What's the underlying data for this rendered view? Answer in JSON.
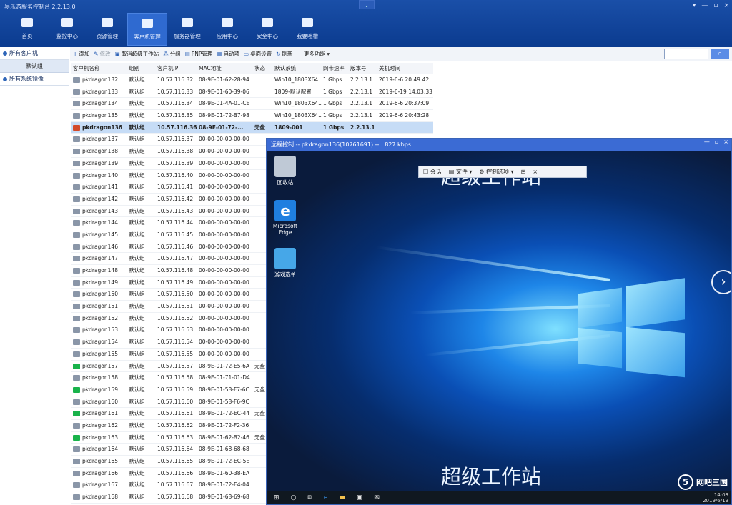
{
  "app": {
    "title": "易乐游服务控制台 2.2.13.0",
    "collapse_glyph": "⌄",
    "window_controls": [
      "▾",
      "—",
      "▫",
      "×"
    ]
  },
  "nav": {
    "items": [
      {
        "label": "首页",
        "icon": "home-icon"
      },
      {
        "label": "监控中心",
        "icon": "eye-icon"
      },
      {
        "label": "资源管理",
        "icon": "gamepad-icon"
      },
      {
        "label": "客户机管理",
        "icon": "monitor-icon",
        "active": true
      },
      {
        "label": "服务器管理",
        "icon": "server-icon"
      },
      {
        "label": "应用中心",
        "icon": "toolbox-icon"
      },
      {
        "label": "安全中心",
        "icon": "shield-icon"
      },
      {
        "label": "我要吐槽",
        "icon": "comment-icon"
      }
    ]
  },
  "sidebar": {
    "all_clients": "所有客户机",
    "default_group": "默认组",
    "all_images": "所有系统镜像"
  },
  "actions": {
    "add": "添加",
    "modify": "修改",
    "cancel_super": "取消超级工作站",
    "group": "分组",
    "pnp": "PNP管理",
    "boot": "启动项",
    "desktop": "桌面设置",
    "refresh": "刷新",
    "more": "更多功能"
  },
  "search": {
    "placeholder": "",
    "button_glyph": "⌕"
  },
  "table": {
    "headers": [
      "客户机名称",
      "组别",
      "客户机IP",
      "MAC地址",
      "状态",
      "默认系统",
      "网卡速率",
      "版本号",
      "关机时间"
    ],
    "rows": [
      {
        "name": "pkdragon132",
        "group": "默认组",
        "ip": "10.57.116.32",
        "mac": "08-9E-01-62-28-94",
        "status": "",
        "os": "Win10_1803X64...",
        "speed": "1 Gbps",
        "ver": "2.2.13.1",
        "shut": "2019-6-6 20:49:42",
        "icon": "gray"
      },
      {
        "name": "pkdragon133",
        "group": "默认组",
        "ip": "10.57.116.33",
        "mac": "08-9E-01-60-39-06",
        "status": "",
        "os": "1809-默认配置",
        "speed": "1 Gbps",
        "ver": "2.2.13.1",
        "shut": "2019-6-19 14:03:33",
        "icon": "gray"
      },
      {
        "name": "pkdragon134",
        "group": "默认组",
        "ip": "10.57.116.34",
        "mac": "08-9E-01-4A-01-CE",
        "status": "",
        "os": "Win10_1803X64...",
        "speed": "1 Gbps",
        "ver": "2.2.13.1",
        "shut": "2019-6-6 20:37:09",
        "icon": "gray"
      },
      {
        "name": "pkdragon135",
        "group": "默认组",
        "ip": "10.57.116.35",
        "mac": "08-9E-01-72-B7-98",
        "status": "",
        "os": "Win10_1803X64...",
        "speed": "1 Gbps",
        "ver": "2.2.13.1",
        "shut": "2019-6-6 20:43:28",
        "icon": "gray"
      },
      {
        "name": "pkdragon136",
        "group": "默认组",
        "ip": "10.57.116.36",
        "mac": "08-9E-01-72-...",
        "status": "无盘",
        "os": "1809-001",
        "speed": "1 Gbps",
        "ver": "2.2.13.1",
        "shut": "",
        "icon": "red",
        "selected": true
      },
      {
        "name": "pkdragon137",
        "group": "默认组",
        "ip": "10.57.116.37",
        "mac": "00-00-00-00-00-00",
        "status": "",
        "os": "",
        "speed": "",
        "ver": "",
        "shut": "",
        "icon": "gray"
      },
      {
        "name": "pkdragon138",
        "group": "默认组",
        "ip": "10.57.116.38",
        "mac": "00-00-00-00-00-00",
        "status": "",
        "os": "",
        "speed": "",
        "ver": "",
        "shut": "",
        "icon": "gray"
      },
      {
        "name": "pkdragon139",
        "group": "默认组",
        "ip": "10.57.116.39",
        "mac": "00-00-00-00-00-00",
        "status": "",
        "os": "",
        "speed": "",
        "ver": "",
        "shut": "",
        "icon": "gray"
      },
      {
        "name": "pkdragon140",
        "group": "默认组",
        "ip": "10.57.116.40",
        "mac": "00-00-00-00-00-00",
        "status": "",
        "os": "",
        "speed": "",
        "ver": "",
        "shut": "",
        "icon": "gray"
      },
      {
        "name": "pkdragon141",
        "group": "默认组",
        "ip": "10.57.116.41",
        "mac": "00-00-00-00-00-00",
        "status": "",
        "os": "",
        "speed": "",
        "ver": "",
        "shut": "",
        "icon": "gray"
      },
      {
        "name": "pkdragon142",
        "group": "默认组",
        "ip": "10.57.116.42",
        "mac": "00-00-00-00-00-00",
        "status": "",
        "os": "",
        "speed": "",
        "ver": "",
        "shut": "",
        "icon": "gray"
      },
      {
        "name": "pkdragon143",
        "group": "默认组",
        "ip": "10.57.116.43",
        "mac": "00-00-00-00-00-00",
        "status": "",
        "os": "",
        "speed": "",
        "ver": "",
        "shut": "",
        "icon": "gray"
      },
      {
        "name": "pkdragon144",
        "group": "默认组",
        "ip": "10.57.116.44",
        "mac": "00-00-00-00-00-00",
        "status": "",
        "os": "",
        "speed": "",
        "ver": "",
        "shut": "",
        "icon": "gray"
      },
      {
        "name": "pkdragon145",
        "group": "默认组",
        "ip": "10.57.116.45",
        "mac": "00-00-00-00-00-00",
        "status": "",
        "os": "",
        "speed": "",
        "ver": "",
        "shut": "",
        "icon": "gray"
      },
      {
        "name": "pkdragon146",
        "group": "默认组",
        "ip": "10.57.116.46",
        "mac": "00-00-00-00-00-00",
        "status": "",
        "os": "",
        "speed": "",
        "ver": "",
        "shut": "",
        "icon": "gray"
      },
      {
        "name": "pkdragon147",
        "group": "默认组",
        "ip": "10.57.116.47",
        "mac": "00-00-00-00-00-00",
        "status": "",
        "os": "",
        "speed": "",
        "ver": "",
        "shut": "",
        "icon": "gray"
      },
      {
        "name": "pkdragon148",
        "group": "默认组",
        "ip": "10.57.116.48",
        "mac": "00-00-00-00-00-00",
        "status": "",
        "os": "",
        "speed": "",
        "ver": "",
        "shut": "",
        "icon": "gray"
      },
      {
        "name": "pkdragon149",
        "group": "默认组",
        "ip": "10.57.116.49",
        "mac": "00-00-00-00-00-00",
        "status": "",
        "os": "",
        "speed": "",
        "ver": "",
        "shut": "",
        "icon": "gray"
      },
      {
        "name": "pkdragon150",
        "group": "默认组",
        "ip": "10.57.116.50",
        "mac": "00-00-00-00-00-00",
        "status": "",
        "os": "",
        "speed": "",
        "ver": "",
        "shut": "",
        "icon": "gray"
      },
      {
        "name": "pkdragon151",
        "group": "默认组",
        "ip": "10.57.116.51",
        "mac": "00-00-00-00-00-00",
        "status": "",
        "os": "",
        "speed": "",
        "ver": "",
        "shut": "",
        "icon": "gray"
      },
      {
        "name": "pkdragon152",
        "group": "默认组",
        "ip": "10.57.116.52",
        "mac": "00-00-00-00-00-00",
        "status": "",
        "os": "",
        "speed": "",
        "ver": "",
        "shut": "",
        "icon": "gray"
      },
      {
        "name": "pkdragon153",
        "group": "默认组",
        "ip": "10.57.116.53",
        "mac": "00-00-00-00-00-00",
        "status": "",
        "os": "",
        "speed": "",
        "ver": "",
        "shut": "",
        "icon": "gray"
      },
      {
        "name": "pkdragon154",
        "group": "默认组",
        "ip": "10.57.116.54",
        "mac": "00-00-00-00-00-00",
        "status": "",
        "os": "",
        "speed": "",
        "ver": "",
        "shut": "",
        "icon": "gray"
      },
      {
        "name": "pkdragon155",
        "group": "默认组",
        "ip": "10.57.116.55",
        "mac": "00-00-00-00-00-00",
        "status": "",
        "os": "",
        "speed": "",
        "ver": "",
        "shut": "",
        "icon": "gray"
      },
      {
        "name": "pkdragon157",
        "group": "默认组",
        "ip": "10.57.116.57",
        "mac": "08-9E-01-72-E5-6A",
        "status": "无盘",
        "os": "",
        "speed": "",
        "ver": "",
        "shut": "",
        "icon": "green"
      },
      {
        "name": "pkdragon158",
        "group": "默认组",
        "ip": "10.57.116.58",
        "mac": "08-9E-01-71-01-D4",
        "status": "",
        "os": "",
        "speed": "",
        "ver": "",
        "shut": "",
        "icon": "gray"
      },
      {
        "name": "pkdragon159",
        "group": "默认组",
        "ip": "10.57.116.59",
        "mac": "08-9E-01-58-F7-6C",
        "status": "无盘",
        "os": "",
        "speed": "",
        "ver": "",
        "shut": "",
        "icon": "green"
      },
      {
        "name": "pkdragon160",
        "group": "默认组",
        "ip": "10.57.116.60",
        "mac": "08-9E-01-58-F6-9C",
        "status": "",
        "os": "",
        "speed": "",
        "ver": "",
        "shut": "",
        "icon": "gray"
      },
      {
        "name": "pkdragon161",
        "group": "默认组",
        "ip": "10.57.116.61",
        "mac": "08-9E-01-72-EC-44",
        "status": "无盘",
        "os": "",
        "speed": "",
        "ver": "",
        "shut": "",
        "icon": "green"
      },
      {
        "name": "pkdragon162",
        "group": "默认组",
        "ip": "10.57.116.62",
        "mac": "08-9E-01-72-F2-36",
        "status": "",
        "os": "",
        "speed": "",
        "ver": "",
        "shut": "",
        "icon": "gray"
      },
      {
        "name": "pkdragon163",
        "group": "默认组",
        "ip": "10.57.116.63",
        "mac": "08-9E-01-62-B2-46",
        "status": "无盘",
        "os": "",
        "speed": "",
        "ver": "",
        "shut": "",
        "icon": "green"
      },
      {
        "name": "pkdragon164",
        "group": "默认组",
        "ip": "10.57.116.64",
        "mac": "08-9E-01-68-68-68",
        "status": "",
        "os": "",
        "speed": "",
        "ver": "",
        "shut": "",
        "icon": "gray"
      },
      {
        "name": "pkdragon165",
        "group": "默认组",
        "ip": "10.57.116.65",
        "mac": "08-9E-01-72-EC-5E",
        "status": "",
        "os": "",
        "speed": "",
        "ver": "",
        "shut": "",
        "icon": "gray"
      },
      {
        "name": "pkdragon166",
        "group": "默认组",
        "ip": "10.57.116.66",
        "mac": "08-9E-01-60-38-EA",
        "status": "",
        "os": "",
        "speed": "",
        "ver": "",
        "shut": "",
        "icon": "gray"
      },
      {
        "name": "pkdragon167",
        "group": "默认组",
        "ip": "10.57.116.67",
        "mac": "08-9E-01-72-E4-04",
        "status": "",
        "os": "",
        "speed": "",
        "ver": "",
        "shut": "",
        "icon": "gray"
      },
      {
        "name": "pkdragon168",
        "group": "默认组",
        "ip": "10.57.116.68",
        "mac": "08-9E-01-68-69-68",
        "status": "",
        "os": "",
        "speed": "",
        "ver": "",
        "shut": "",
        "icon": "gray"
      }
    ]
  },
  "remote": {
    "title": "远程控制 -- pkdragon136(10761691) -- : 827 kbps",
    "toolbar": {
      "chat": "会话",
      "file": "文件",
      "control": "控制选项"
    },
    "desktop_title": "超级工作站",
    "icons": [
      {
        "label": "回收站",
        "icon": "recycle-bin-icon",
        "color": "#bfc9d6"
      },
      {
        "label": "Microsoft Edge",
        "icon": "edge-icon",
        "color": "#1f7fe0"
      },
      {
        "label": "游戏选单",
        "icon": "game-menu-icon",
        "color": "#46a7e8"
      }
    ],
    "tray": {
      "time": "14:03",
      "date": "2019/6/19"
    }
  },
  "watermark": {
    "logo": "5",
    "text": "网吧三国"
  }
}
